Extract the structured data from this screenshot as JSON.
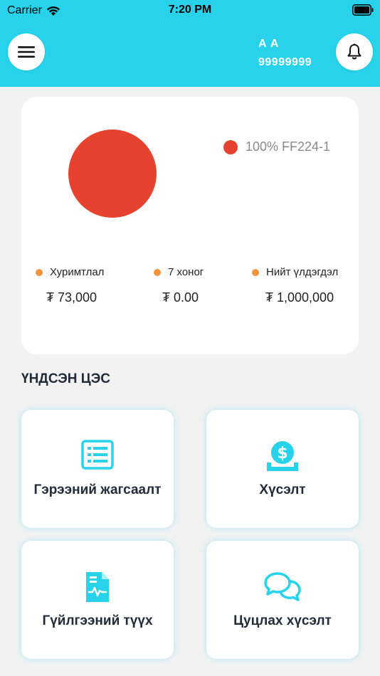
{
  "status_bar": {
    "carrier": "Carrier",
    "time": "7:20 PM"
  },
  "header": {
    "user_name": "A A",
    "user_phone": "99999999",
    "background_color": "#27d2ea",
    "menu_icon": "hamburger-icon",
    "notification_icon": "bell-icon"
  },
  "summary": {
    "chart_data": {
      "type": "pie",
      "slices": [
        {
          "label": "FF224-1",
          "value": 100,
          "color": "#e5432f"
        }
      ],
      "legend": [
        {
          "text": "100% FF224-1",
          "color": "#e5432f"
        }
      ]
    },
    "stats": [
      {
        "label": "Хуримтлал",
        "value": "₮ 73,000",
        "dot_color": "#f5953b"
      },
      {
        "label": "7 хоног",
        "value": "₮ 0.00",
        "dot_color": "#f5953b"
      },
      {
        "label": "Нийт үлдэгдэл",
        "value": "₮ 1,000,000",
        "dot_color": "#f5953b"
      }
    ]
  },
  "main_menu": {
    "title": "ҮНДСЭН ЦЭС",
    "accent_color": "#27d2ea",
    "items": [
      {
        "label": "Гэрээний жагсаалт",
        "icon": "list-icon"
      },
      {
        "label": "Хүсэлт",
        "icon": "money-request-icon"
      },
      {
        "label": "Гүйлгээний түүх",
        "icon": "transaction-document-icon"
      },
      {
        "label": "Цуцлах хүсэлт",
        "icon": "chat-bubbles-icon"
      }
    ]
  }
}
